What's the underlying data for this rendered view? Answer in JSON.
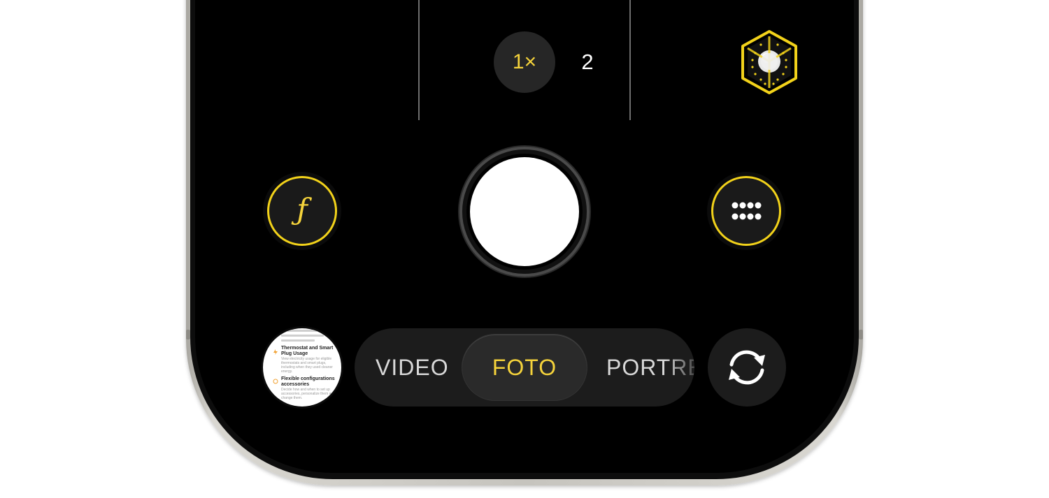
{
  "zoom": {
    "selected_label": "1×",
    "other_label": "2"
  },
  "modes": {
    "items": [
      "VIDEO",
      "FOTO",
      "PORTRE"
    ],
    "selected": "FOTO"
  },
  "thumbnail": {
    "entries": [
      {
        "title": "Thermostat and Smart Plug Usage",
        "body": "View electricity usage for eligible thermostats and smart plugs, including when they used cleaner energy."
      },
      {
        "title": "Flexible configurations accessories",
        "body": "Decide how and when to set up accessories, personalize them and change them."
      }
    ]
  },
  "icons": {
    "aperture": "aperture-f-icon",
    "controls": "grid-dots-icon",
    "flip": "camera-flip-icon",
    "spatial": "spatial-cube-icon"
  },
  "colors": {
    "accent_yellow": "#f5d33b",
    "screen_black": "#000000",
    "control_gray": "#1c1c1c"
  }
}
